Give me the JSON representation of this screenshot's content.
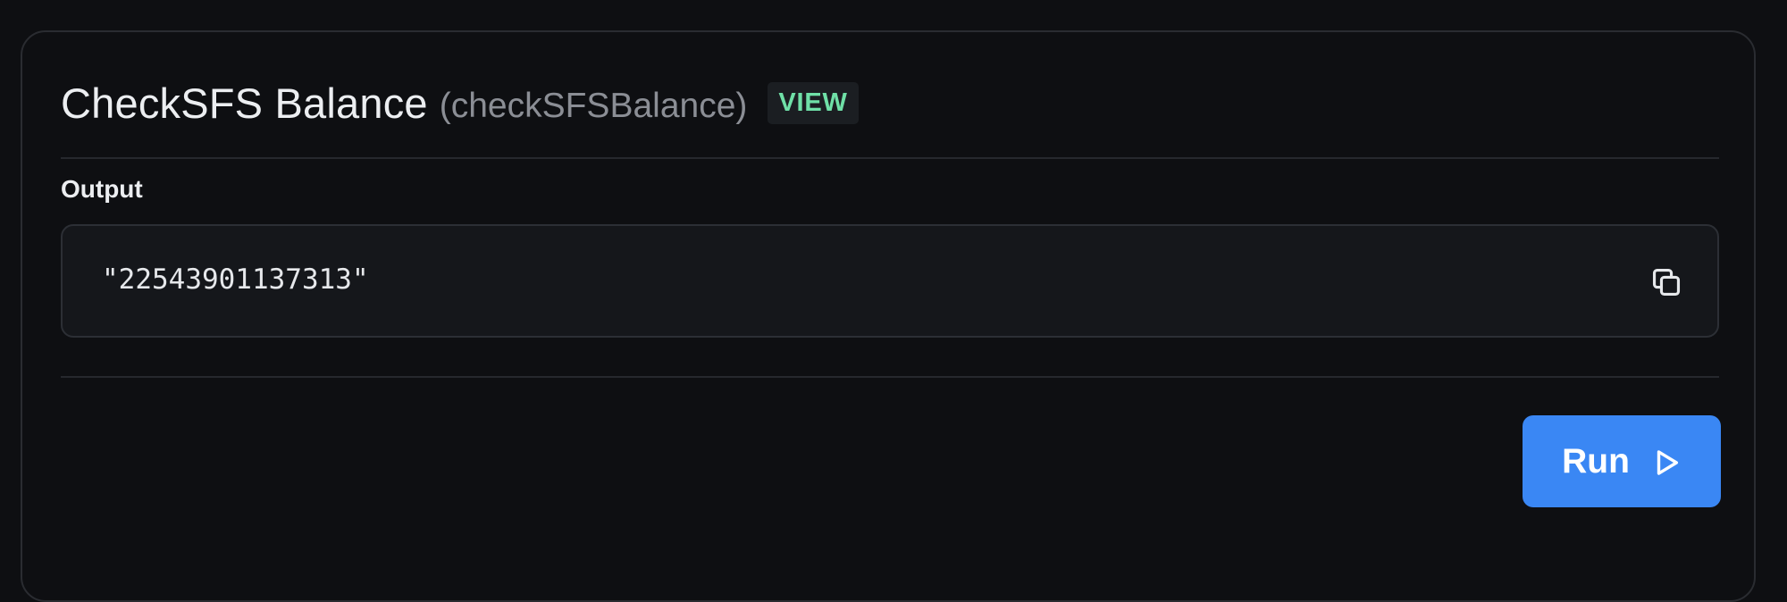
{
  "function_card": {
    "title": "CheckSFS Balance",
    "function_name": "(checkSFSBalance)",
    "badge": "VIEW",
    "output_label": "Output",
    "output_value": "\"22543901137313\"",
    "copy_icon": "copy-icon",
    "run_label": "Run",
    "run_icon": "play-icon"
  },
  "colors": {
    "background": "#0e0f12",
    "badge_text": "#6fe0a7",
    "run_button": "#3a87f4"
  }
}
